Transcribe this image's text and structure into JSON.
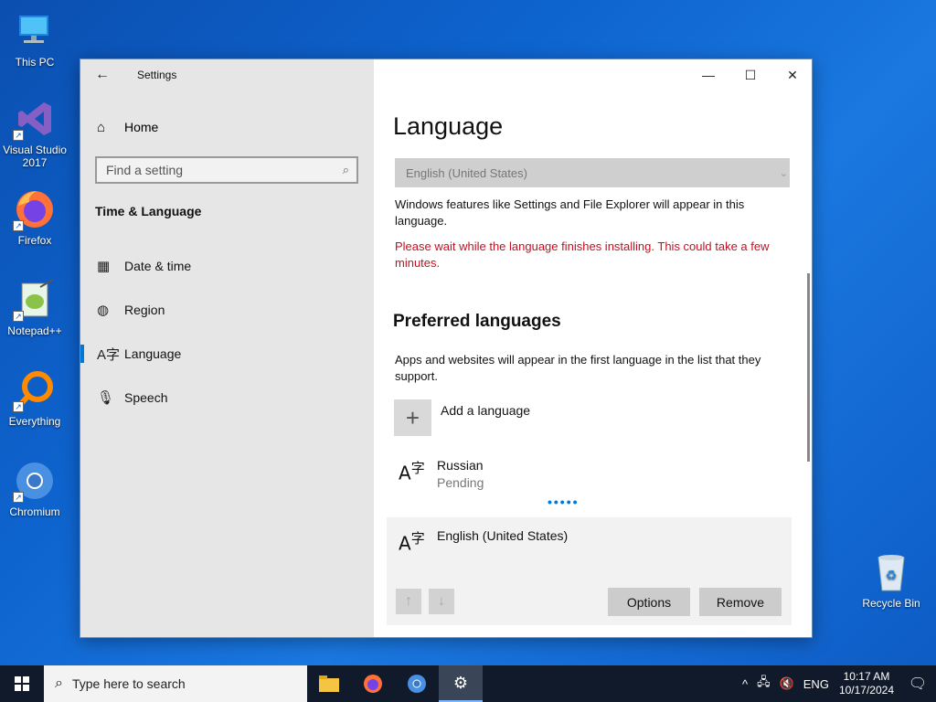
{
  "desktop": {
    "icons": [
      {
        "label": "This PC"
      },
      {
        "label": "Visual Studio 2017"
      },
      {
        "label": "Firefox"
      },
      {
        "label": "Notepad++"
      },
      {
        "label": "Everything"
      },
      {
        "label": "Chromium"
      },
      {
        "label": "Recycle Bin"
      }
    ]
  },
  "window": {
    "app_title": "Settings",
    "controls": {
      "minimize": "—",
      "maximize": "☐",
      "close": "✕"
    }
  },
  "sidebar": {
    "home_label": "Home",
    "search_placeholder": "Find a setting",
    "section_title": "Time & Language",
    "items": [
      {
        "label": "Date & time",
        "icon": "calendar-clock-icon"
      },
      {
        "label": "Region",
        "icon": "globe-icon"
      },
      {
        "label": "Language",
        "icon": "language-icon",
        "active": true
      },
      {
        "label": "Speech",
        "icon": "microphone-icon"
      }
    ]
  },
  "content": {
    "title": "Language",
    "display_language_value": "English (United States)",
    "display_language_desc": "Windows features like Settings and File Explorer will appear in this language.",
    "install_warning": "Please wait while the language finishes installing. This could take a few minutes.",
    "preferred_heading": "Preferred languages",
    "preferred_desc": "Apps and websites will appear in the first language in the list that they support.",
    "add_language_label": "Add a language",
    "languages": [
      {
        "name": "Russian",
        "status": "Pending"
      },
      {
        "name": "English (United States)",
        "status": ""
      }
    ],
    "options_label": "Options",
    "remove_label": "Remove"
  },
  "taskbar": {
    "search_placeholder": "Type here to search",
    "tray_language": "ENG",
    "time": "10:17 AM",
    "date": "10/17/2024"
  },
  "colors": {
    "accent": "#0078d7",
    "warning": "#c50f1f",
    "desktop_blue": "#0e64cf"
  }
}
